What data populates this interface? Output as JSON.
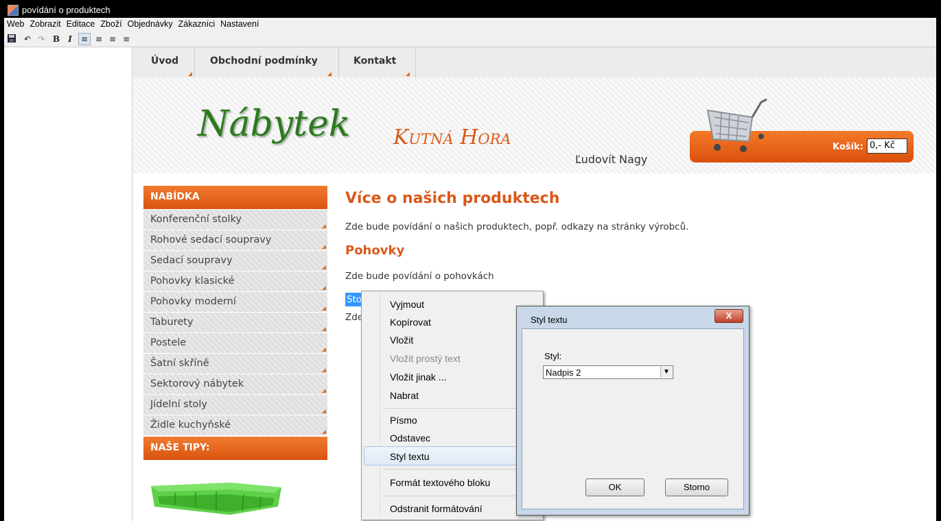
{
  "window": {
    "title": "povídání o produktech"
  },
  "menu": [
    "Web",
    "Zobrazit",
    "Editace",
    "Zboží",
    "Objednávky",
    "Zákazníci",
    "Nastavení"
  ],
  "toolbar": {
    "bold": "B",
    "italic": "I"
  },
  "nav": {
    "tabs": [
      "Úvod",
      "Obchodní podmínky",
      "Kontakt"
    ]
  },
  "header": {
    "logo": "Nábytek",
    "city": "Kutná Hora",
    "owner": "Ľudovít Nagy",
    "cart_label": "Košík:",
    "cart_value": "0,- Kč"
  },
  "sidebar": {
    "heading": "NABÍDKA",
    "items": [
      "Konferenční stolky",
      "Rohové sedací soupravy",
      "Sedací soupravy",
      "Pohovky klasické",
      "Pohovky moderní",
      "Taburety",
      "Postele",
      "Šatní skříně",
      "Sektorový nábytek",
      "Jídelní stoly",
      "Židle kuchyňské"
    ],
    "tips_heading": "NAŠE TIPY:"
  },
  "main": {
    "title": "Více o našich produktech",
    "intro": "Zde bude povídání o našich produktech, popř. odkazy na stránky výrobců.",
    "section": "Pohovky",
    "section_text": "Zde bude povídání o pohovkách",
    "selected_text": "Stol",
    "partial_text": "Zde"
  },
  "context_menu": {
    "items": [
      "Vyjmout",
      "Kopírovat",
      "Vložit",
      "Vložit prostý text",
      "Vložit jinak ...",
      "Nabrat",
      "Písmo",
      "Odstavec",
      "Styl textu",
      "Formát textového bloku",
      "Odstranit formátování"
    ]
  },
  "dialog": {
    "title": "Styl textu",
    "close": "X",
    "label": "Styl:",
    "value": "Nadpis 2",
    "ok": "OK",
    "cancel": "Storno"
  }
}
